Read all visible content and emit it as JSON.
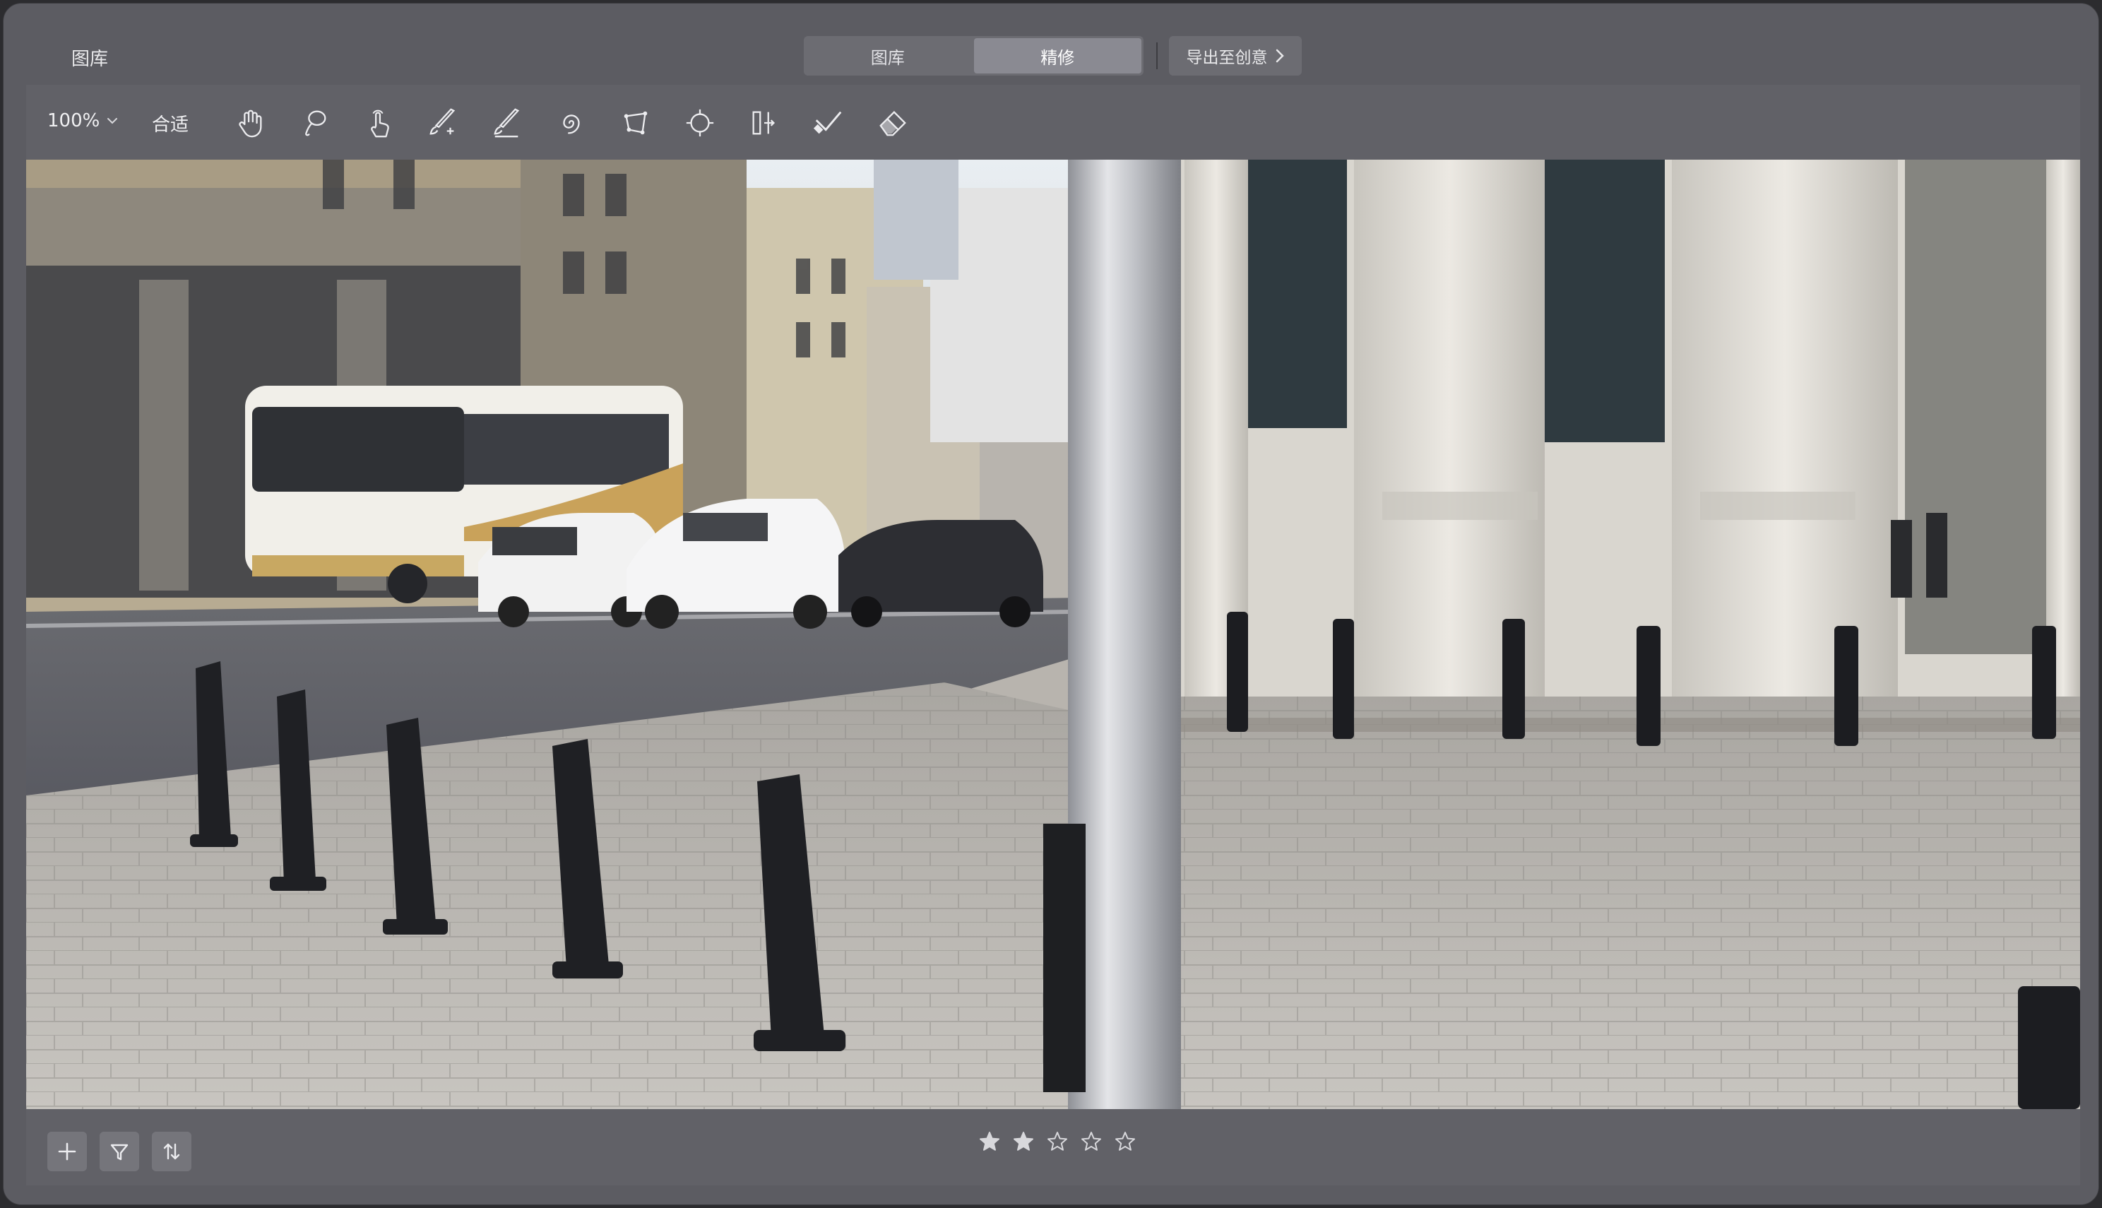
{
  "window": {
    "title": "图库"
  },
  "top_tabs": [
    {
      "label": "图库",
      "active": false
    },
    {
      "label": "精修",
      "active": true
    }
  ],
  "export": {
    "label": "导出至创意",
    "icon": "chevron-right-icon"
  },
  "toolbar": {
    "zoom_label": "100%",
    "zoom_icon": "chevron-down-icon",
    "fit_label": "合适",
    "tools": [
      "hand-icon",
      "lasso-icon",
      "touch-icon",
      "brush-plus-icon",
      "brush-minus-icon",
      "swirl-icon",
      "transform-icon",
      "radial-icon",
      "split-icon",
      "check-brush-icon",
      "eraser-icon"
    ]
  },
  "bottom": {
    "buttons": [
      "plus-icon",
      "filter-icon",
      "sort-icon"
    ],
    "rating": 2,
    "max_rating": 5
  },
  "colors": {
    "window_bg": "#5c5c62",
    "toolbar_bg": "#616167",
    "active_tab": "#8a8a92",
    "icon": "#ececef"
  }
}
